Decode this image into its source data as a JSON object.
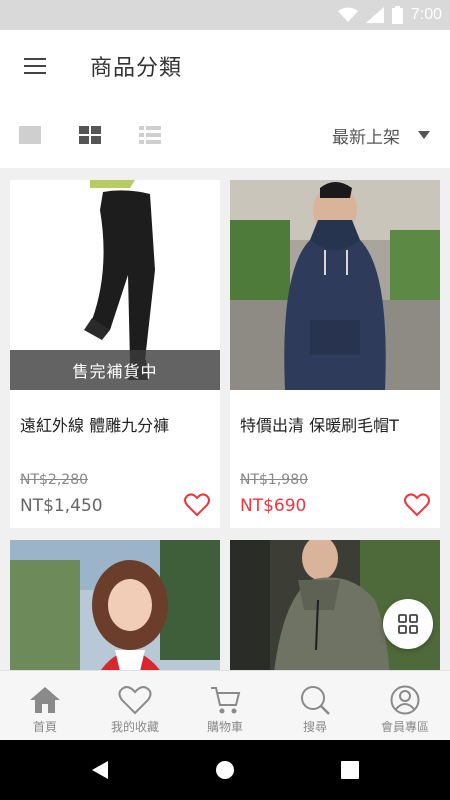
{
  "status_bar": {
    "time": "7:00"
  },
  "header": {
    "title": "商品分類"
  },
  "toolbar": {
    "sort_label": "最新上架"
  },
  "products": [
    {
      "name": "遠紅外線 體雕九分褲",
      "price_original": "NT$2,280",
      "price_sale": "NT$1,450",
      "badge": "售完補貨中",
      "price_color": "#666666"
    },
    {
      "name": "特價出清 保暖刷毛帽T",
      "price_original": "NT$1,980",
      "price_sale": "NT$690",
      "badge": "",
      "price_color": "#f0353f"
    },
    {
      "name": "",
      "price_original": "",
      "price_sale": "",
      "badge": ""
    },
    {
      "name": "",
      "price_original": "",
      "price_sale": "",
      "badge": ""
    }
  ],
  "bottom_nav": [
    {
      "label": "首頁",
      "icon": "home-icon"
    },
    {
      "label": "我的收藏",
      "icon": "heart-icon"
    },
    {
      "label": "購物車",
      "icon": "cart-icon"
    },
    {
      "label": "搜尋",
      "icon": "search-icon"
    },
    {
      "label": "會員專區",
      "icon": "user-icon"
    }
  ],
  "colors": {
    "accent": "#f0353f",
    "icon_gray": "#8a8a8a"
  }
}
